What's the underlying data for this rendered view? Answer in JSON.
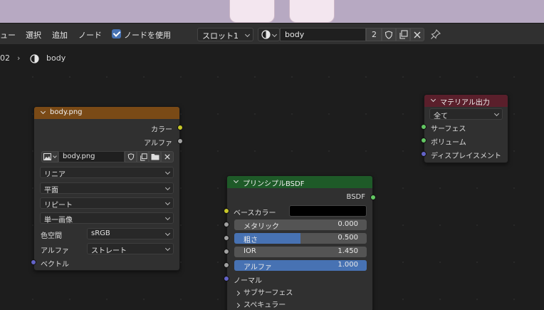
{
  "header": {
    "menu": [
      {
        "label": "ュー"
      },
      {
        "label": "選択"
      },
      {
        "label": "追加"
      },
      {
        "label": "ノード"
      }
    ],
    "use_nodes_label": "ノードを使用",
    "slot_label": "スロット1",
    "material_name": "body",
    "user_count": "2"
  },
  "breadcrumb": {
    "prefix": "02",
    "material": "body"
  },
  "image_node": {
    "title": "body.png",
    "outputs": {
      "color": "カラー",
      "alpha": "アルファ"
    },
    "image_name": "body.png",
    "interpolation": "リニア",
    "projection": "平面",
    "extension": "リピート",
    "source": "単一画像",
    "color_space_label": "色空間",
    "color_space_value": "sRGB",
    "alpha_label": "アルファ",
    "alpha_value": "ストレート",
    "vector_label": "ベクトル"
  },
  "output_node": {
    "title": "マテリアル出力",
    "target": "全て",
    "inputs": {
      "surface": "サーフェス",
      "volume": "ボリューム",
      "displacement": "ディスプレイスメント"
    }
  },
  "bsdf_node": {
    "title": "プリンシプルBSDF",
    "output": "BSDF",
    "base_color_label": "ベースカラー",
    "metallic": {
      "label": "メタリック",
      "value": "0.000",
      "fraction": 0.0
    },
    "roughness": {
      "label": "粗さ",
      "value": "0.500",
      "fraction": 0.5
    },
    "ior": {
      "label": "IOR",
      "value": "1.450"
    },
    "alpha": {
      "label": "アルファ",
      "value": "1.000",
      "fraction": 1.0
    },
    "normal_label": "ノーマル",
    "subsurface_label": "サブサーフェス",
    "specular_label": "スペキュラー"
  },
  "colors": {
    "image_header": "#7a4a16",
    "output_header": "#5a1f2b",
    "bsdf_header": "#1e5a28",
    "socket_color": "#c7c729",
    "socket_shader": "#63c763",
    "socket_vector": "#6363c7",
    "socket_float": "#a1a1a1",
    "accent": "#4772b3"
  }
}
